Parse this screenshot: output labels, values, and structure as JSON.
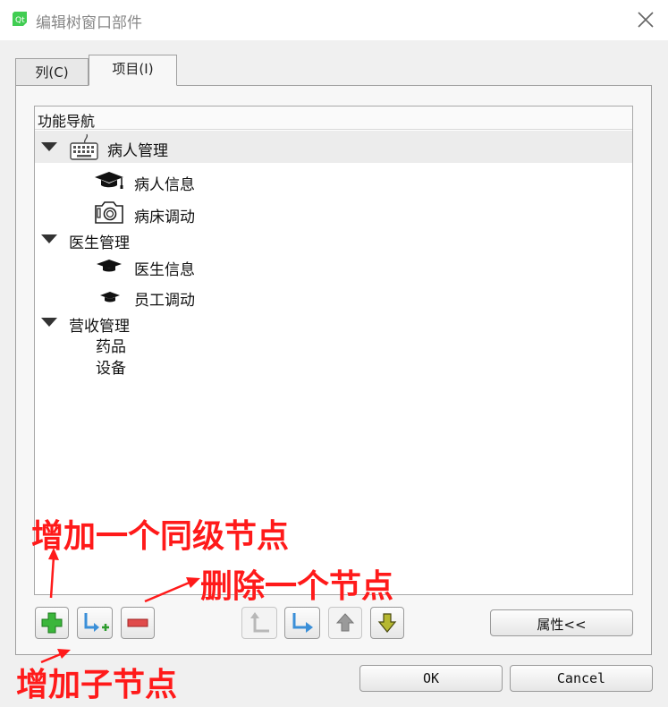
{
  "window": {
    "title": "编辑树窗口部件"
  },
  "tabs": [
    {
      "label": "列(C)"
    },
    {
      "label": "项目(I)"
    }
  ],
  "tree": {
    "header": "功能导航",
    "items": [
      {
        "label": "病人管理",
        "icon": "keyboard-icon"
      },
      {
        "label": "病人信息",
        "icon": "graduation-cap-icon"
      },
      {
        "label": "病床调动",
        "icon": "camera-icon"
      },
      {
        "label": "医生管理",
        "icon": ""
      },
      {
        "label": "医生信息",
        "icon": "graduation-cap-icon"
      },
      {
        "label": "员工调动",
        "icon": "graduation-cap-icon"
      },
      {
        "label": "营收管理",
        "icon": ""
      },
      {
        "label": "药品",
        "icon": ""
      },
      {
        "label": "设备",
        "icon": ""
      }
    ]
  },
  "toolbar": {
    "properties_label": "属性<<"
  },
  "dialog_buttons": {
    "ok_label": "OK",
    "cancel_label": "Cancel"
  },
  "annotations": {
    "add_sibling": "增加一个同级节点",
    "delete_node": "删除一个节点",
    "add_child": "增加子节点"
  },
  "colors": {
    "annotation": "#ff1a1a",
    "add_green": "#3bb63b",
    "remove_red": "#e04a4a",
    "arrow_blue": "#3a8fd8",
    "down_olive": "#b6b830"
  }
}
